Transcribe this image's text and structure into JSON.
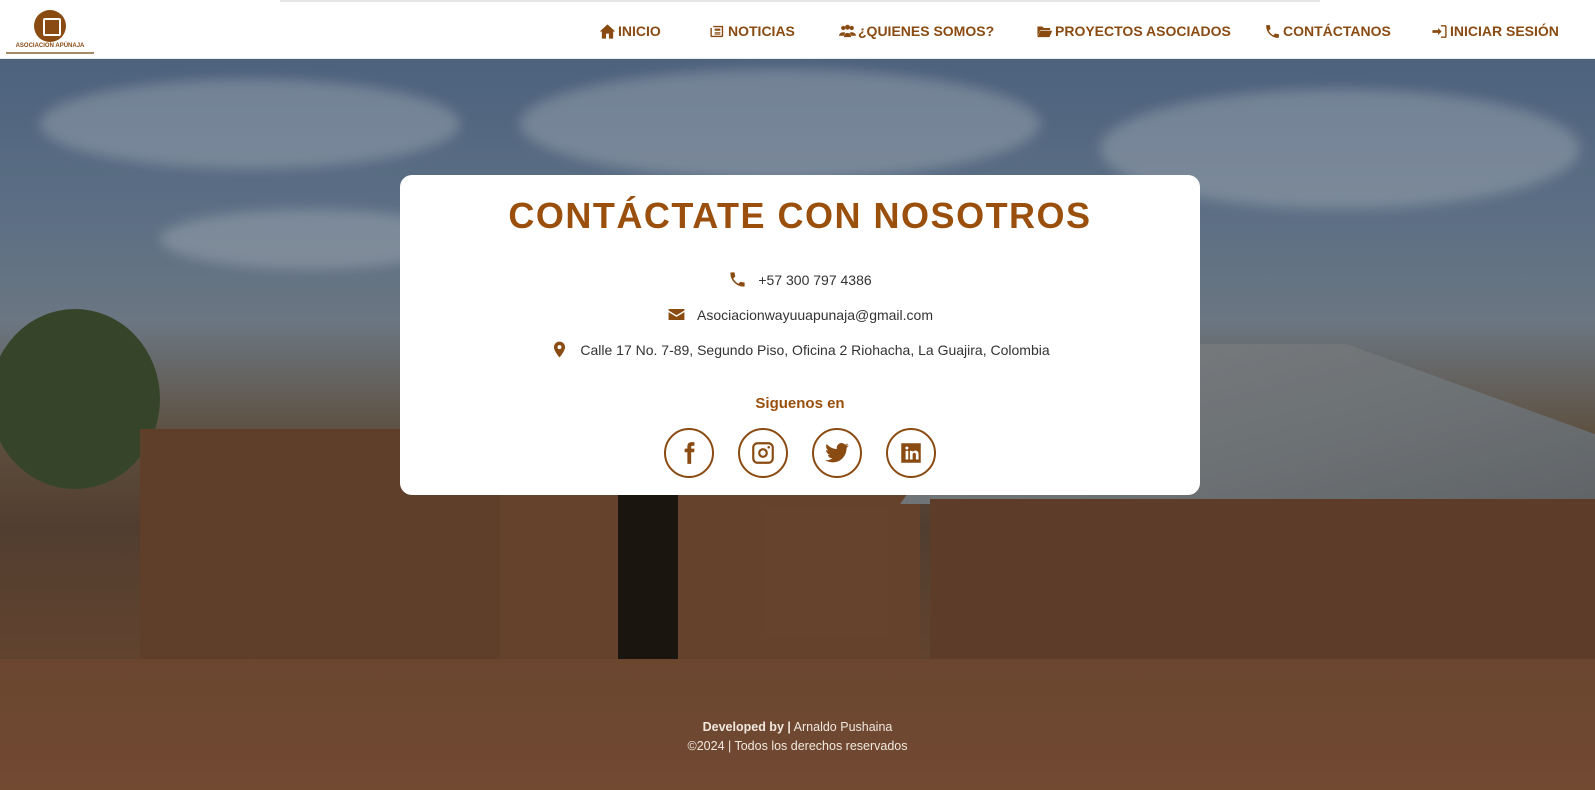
{
  "brand": {
    "logo_text": "ASOCIACION APÜNAJA"
  },
  "nav": {
    "items": [
      {
        "label": "INICIO",
        "icon": "home-icon"
      },
      {
        "label": "NOTICIAS",
        "icon": "newspaper-icon"
      },
      {
        "label": "¿QUIENES SOMOS?",
        "icon": "users-icon"
      },
      {
        "label": "PROYECTOS ASOCIADOS",
        "icon": "folder-open-icon"
      },
      {
        "label": "CONTÁCTANOS",
        "icon": "phone-icon"
      },
      {
        "label": "INICIAR SESIÓN",
        "icon": "sign-in-icon"
      }
    ]
  },
  "contact": {
    "title": "CONTÁCTATE CON NOSOTROS",
    "phone": "+57 300 797 4386",
    "email": "Asociacionwayuuapunaja@gmail.com",
    "address": "Calle 17 No. 7-89, Segundo Piso, Oficina 2 Riohacha, La Guajira, Colombia",
    "follow_label": "Siguenos en",
    "socials": [
      "facebook-icon",
      "instagram-icon",
      "twitter-icon",
      "linkedin-icon"
    ]
  },
  "footer": {
    "developed_by": "Developed by |",
    "developer": "Arnaldo Pushaina",
    "copyright": "©2024 | Todos los derechos reservados"
  },
  "colors": {
    "accent": "#9a4f0c",
    "nav_text": "#8a4b12",
    "card_bg": "#ffffff"
  }
}
